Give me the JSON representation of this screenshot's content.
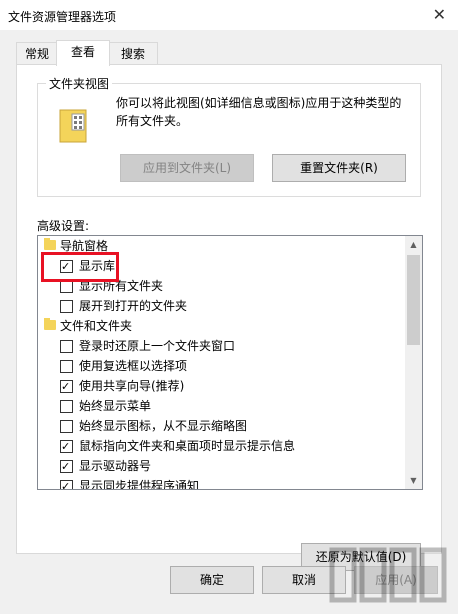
{
  "window": {
    "title": "文件资源管理器选项"
  },
  "tabs": [
    {
      "label": "常规",
      "active": false
    },
    {
      "label": "查看",
      "active": true
    },
    {
      "label": "搜索",
      "active": false
    }
  ],
  "folder_view": {
    "group_title": "文件夹视图",
    "description": "你可以将此视图(如详细信息或图标)应用于这种类型的所有文件夹。",
    "apply_button": "应用到文件夹(L)",
    "reset_button": "重置文件夹(R)"
  },
  "advanced": {
    "label": "高级设置:",
    "items": [
      {
        "type": "folder",
        "label": "导航窗格",
        "indent": 0
      },
      {
        "type": "checkbox",
        "label": "显示库",
        "checked": true,
        "indent": 1
      },
      {
        "type": "checkbox",
        "label": "显示所有文件夹",
        "checked": false,
        "indent": 1
      },
      {
        "type": "checkbox",
        "label": "展开到打开的文件夹",
        "checked": false,
        "indent": 1
      },
      {
        "type": "folder",
        "label": "文件和文件夹",
        "indent": 0
      },
      {
        "type": "checkbox",
        "label": "登录时还原上一个文件夹窗口",
        "checked": false,
        "indent": 1
      },
      {
        "type": "checkbox",
        "label": "使用复选框以选择项",
        "checked": false,
        "indent": 1
      },
      {
        "type": "checkbox",
        "label": "使用共享向导(推荐)",
        "checked": true,
        "indent": 1
      },
      {
        "type": "checkbox",
        "label": "始终显示菜单",
        "checked": false,
        "indent": 1
      },
      {
        "type": "checkbox",
        "label": "始终显示图标，从不显示缩略图",
        "checked": false,
        "indent": 1
      },
      {
        "type": "checkbox",
        "label": "鼠标指向文件夹和桌面项时显示提示信息",
        "checked": true,
        "indent": 1
      },
      {
        "type": "checkbox",
        "label": "显示驱动器号",
        "checked": true,
        "indent": 1
      },
      {
        "type": "checkbox",
        "label": "显示同步提供程序通知",
        "checked": true,
        "indent": 1
      }
    ]
  },
  "restore_defaults_button": "还原为默认值(D)",
  "footer": {
    "ok": "确定",
    "cancel": "取消",
    "apply": "应用(A)"
  },
  "highlight_color": "#e81123"
}
